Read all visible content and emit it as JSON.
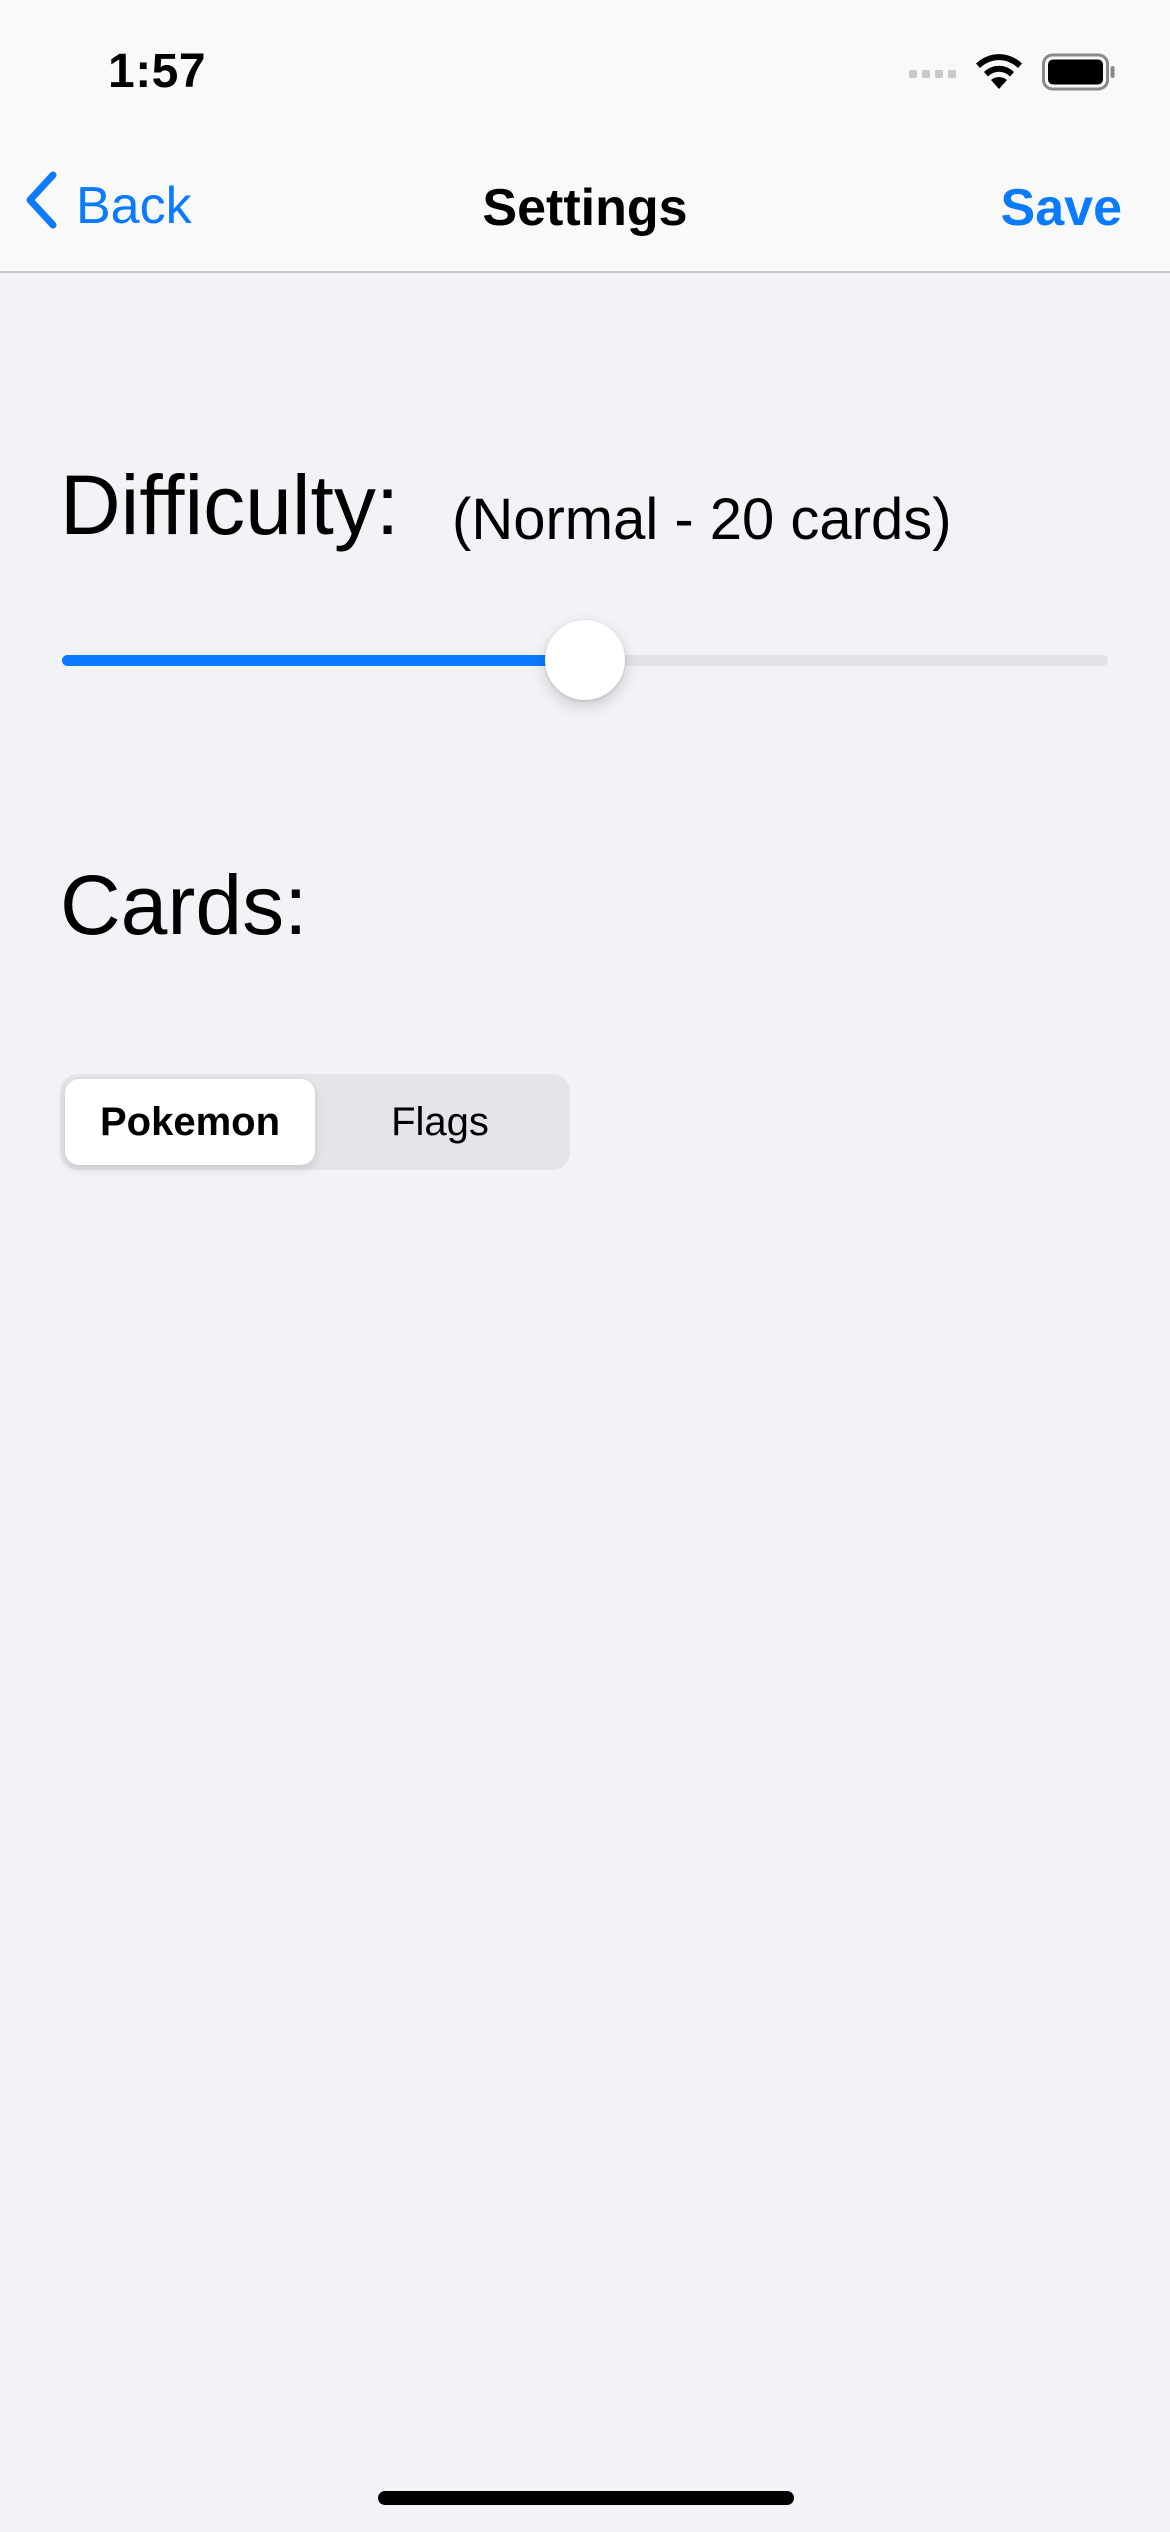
{
  "status_bar": {
    "time": "1:57",
    "icons": [
      "signal-icon",
      "wifi-icon",
      "battery-icon"
    ]
  },
  "nav": {
    "back_label": "Back",
    "title": "Settings",
    "save_label": "Save",
    "back_icon": "chevron-left-icon"
  },
  "difficulty": {
    "label": "Difficulty:",
    "value_text": "(Normal - 20 cards)",
    "slider_fraction": 0.5
  },
  "cards": {
    "label": "Cards:",
    "segments": [
      "Pokemon",
      "Flags"
    ],
    "selected_index": 0
  },
  "colors": {
    "accent": "#0a7aff",
    "background": "#f2f2f7",
    "bar_background": "#f9f9f9",
    "track": "#e2e2e7"
  }
}
